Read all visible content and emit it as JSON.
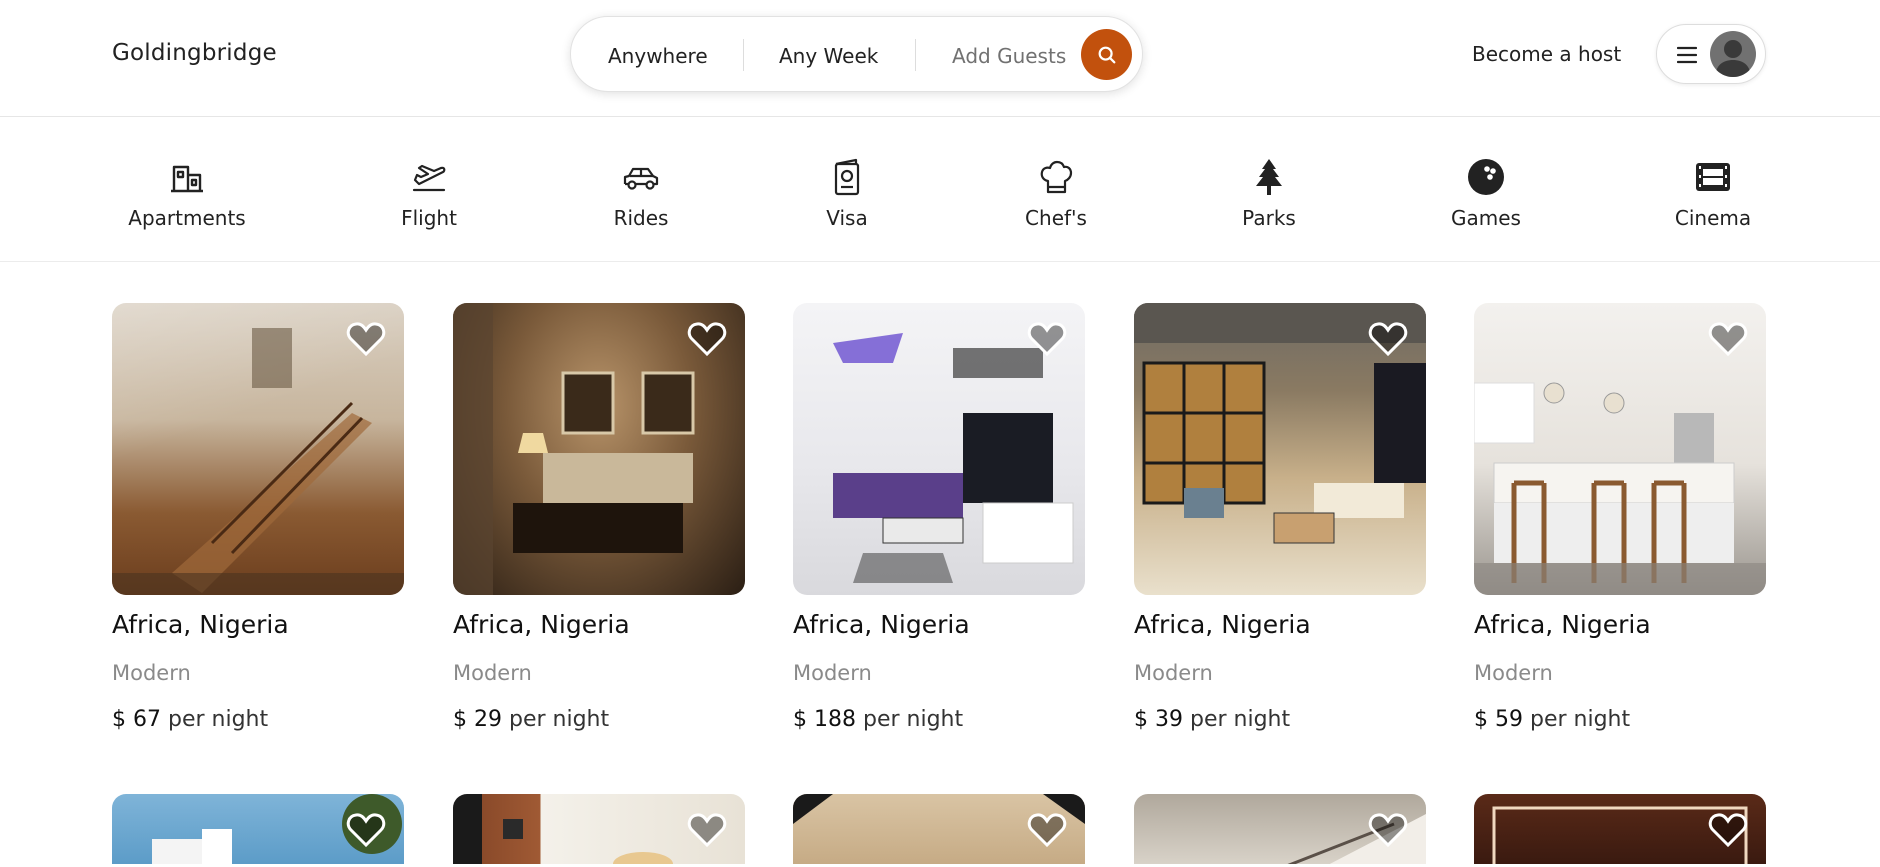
{
  "brand": "Goldingbridge",
  "search": {
    "anywhere": "Anywhere",
    "week": "Any Week",
    "guests": "Add Guests"
  },
  "host_link": "Become a host",
  "colors": {
    "accent": "#c2510d",
    "border": "#dddddd",
    "muted": "#8a8a8a"
  },
  "categories": [
    {
      "label": "Apartments",
      "icon": "apartment-icon"
    },
    {
      "label": "Flight",
      "icon": "plane-icon"
    },
    {
      "label": "Rides",
      "icon": "car-icon"
    },
    {
      "label": "Visa",
      "icon": "passport-icon"
    },
    {
      "label": "Chef's",
      "icon": "chef-hat-icon"
    },
    {
      "label": "Parks",
      "icon": "tree-icon"
    },
    {
      "label": "Games",
      "icon": "bowling-ball-icon"
    },
    {
      "label": "Cinema",
      "icon": "film-icon"
    }
  ],
  "listings": [
    {
      "location": "Africa, Nigeria",
      "type": "Modern",
      "currency": "$",
      "price": "67",
      "per": "per night"
    },
    {
      "location": "Africa, Nigeria",
      "type": "Modern",
      "currency": "$",
      "price": "29",
      "per": "per night"
    },
    {
      "location": "Africa, Nigeria",
      "type": "Modern",
      "currency": "$",
      "price": "188",
      "per": "per night"
    },
    {
      "location": "Africa, Nigeria",
      "type": "Modern",
      "currency": "$",
      "price": "39",
      "per": "per night"
    },
    {
      "location": "Africa, Nigeria",
      "type": "Modern",
      "currency": "$",
      "price": "59",
      "per": "per night"
    }
  ]
}
